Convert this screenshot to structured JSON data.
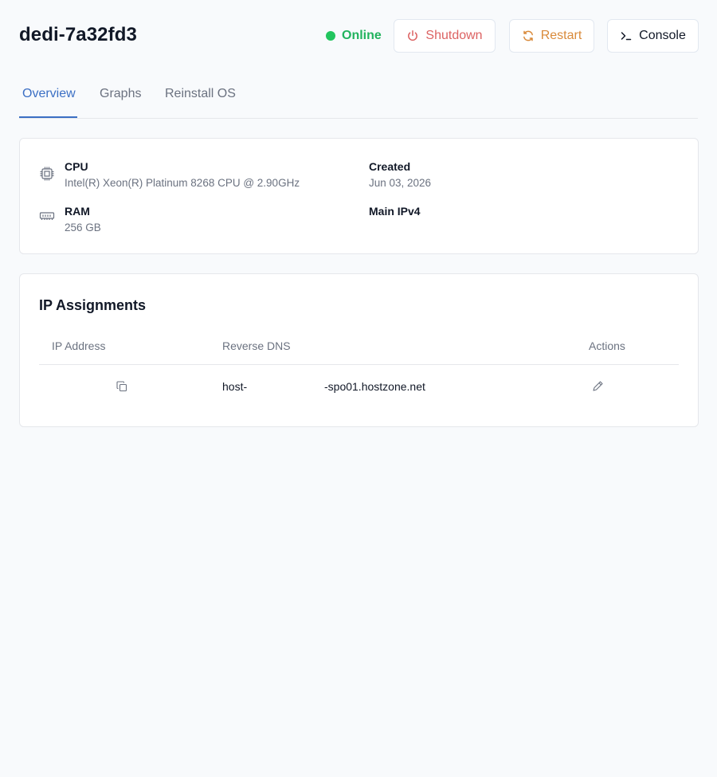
{
  "server": {
    "name": "dedi-7a32fd3",
    "status": "Online",
    "status_color": "#22c55e"
  },
  "actions": {
    "shutdown_label": "Shutdown",
    "restart_label": "Restart",
    "console_label": "Console",
    "shutdown_icon": "power-icon",
    "restart_icon": "refresh-icon",
    "console_icon": "terminal-icon"
  },
  "tabs": [
    {
      "label": "Overview",
      "active": true
    },
    {
      "label": "Graphs",
      "active": false
    },
    {
      "label": "Reinstall OS",
      "active": false
    }
  ],
  "specs": {
    "cpu": {
      "label": "CPU",
      "value": "Intel(R) Xeon(R) Platinum 8268 CPU @ 2.90GHz",
      "icon": "cpu-icon"
    },
    "ram": {
      "label": "RAM",
      "value": "256 GB",
      "icon": "memory-icon"
    },
    "created": {
      "label": "Created",
      "value": "Jun 03, 2026"
    },
    "main_ipv4": {
      "label": "Main IPv4",
      "value": ""
    }
  },
  "ip_assignments": {
    "title": "IP Assignments",
    "columns": [
      "IP Address",
      "Reverse DNS",
      "Actions"
    ],
    "rows": [
      {
        "ip": "",
        "rdns_prefix": "host-",
        "rdns_suffix": "-spo01.hostzone.net"
      }
    ]
  },
  "colors": {
    "accent": "#3b6fc4",
    "online": "#22c55e",
    "shutdown": "#dc6262",
    "restart": "#d98a3a"
  }
}
